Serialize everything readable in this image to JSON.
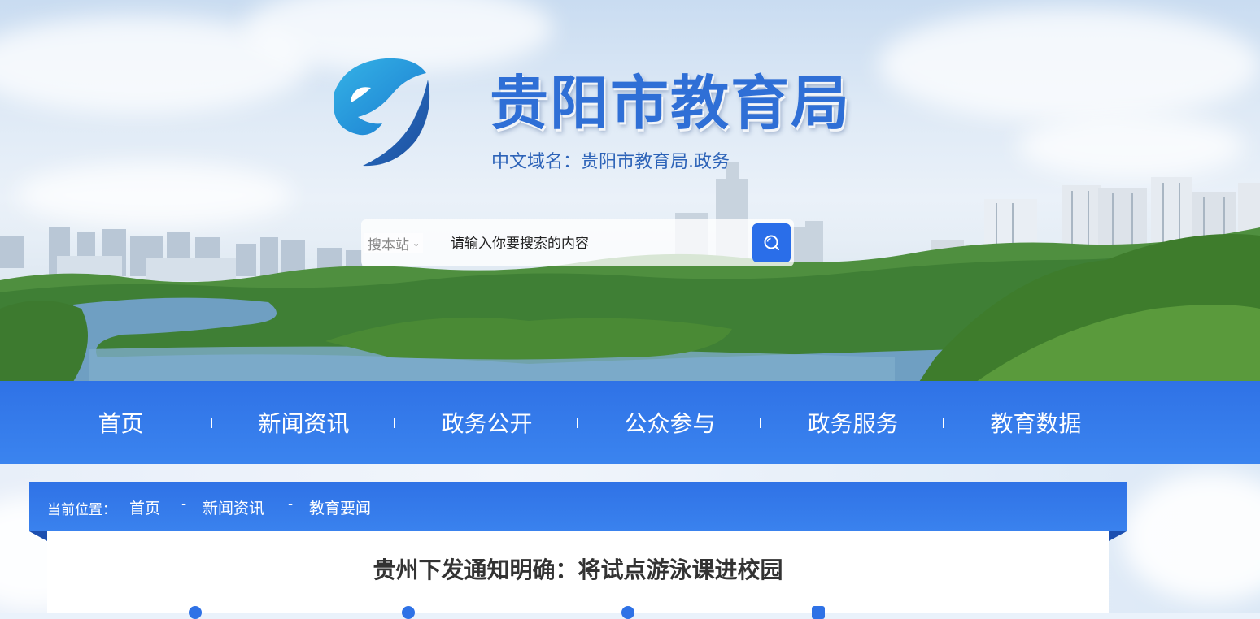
{
  "header": {
    "site_title": "贵阳市教育局",
    "domain_text": "中文域名：贵阳市教育局.政务",
    "logo_icon": "edu-e-logo-icon"
  },
  "search": {
    "scope_label": "搜本站",
    "scope_icon": "chevron-down-icon",
    "placeholder": "请输入你要搜索的内容",
    "button_icon": "search-icon"
  },
  "nav": {
    "items": [
      {
        "label": "首页"
      },
      {
        "label": "新闻资讯"
      },
      {
        "label": "政务公开"
      },
      {
        "label": "公众参与"
      },
      {
        "label": "政务服务"
      },
      {
        "label": "教育数据"
      }
    ]
  },
  "breadcrumb": {
    "label": "当前位置：",
    "items": [
      "首页",
      "新闻资讯",
      "教育要闻"
    ],
    "separator": "-"
  },
  "article": {
    "title": "贵州下发通知明确：将试点游泳课进校园"
  },
  "colors": {
    "primary": "#2f72e6",
    "title_blue": "#2f6fd6",
    "search_button": "#2a6ee9"
  }
}
